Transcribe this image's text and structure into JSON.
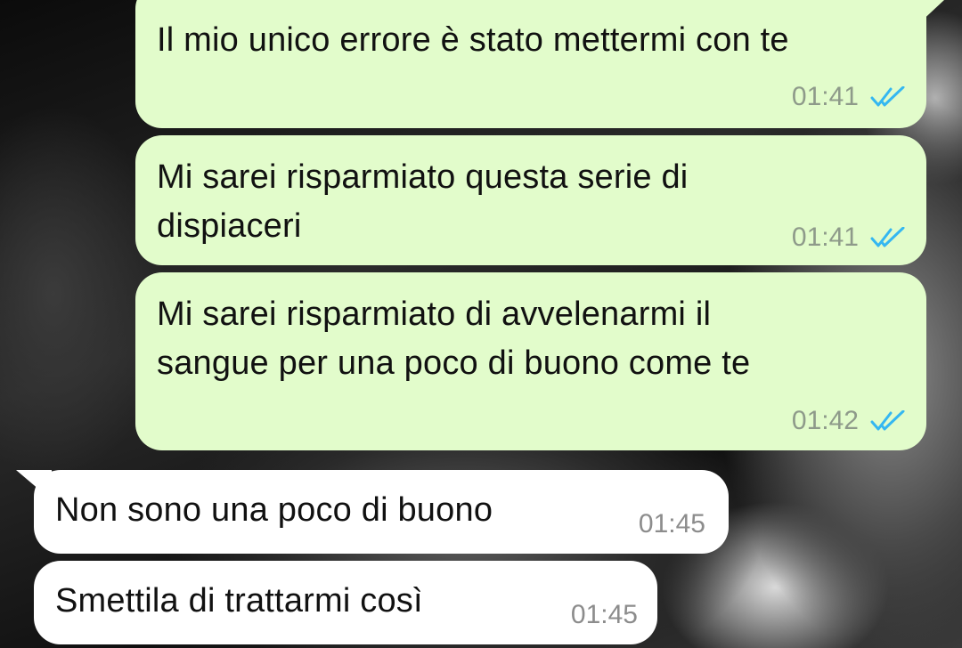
{
  "chat": {
    "messages": [
      {
        "direction": "outgoing",
        "lines": [
          "Il mio unico errore è stato mettermi con te"
        ],
        "time": "01:41",
        "status_icon": "double-check-read-icon"
      },
      {
        "direction": "outgoing",
        "lines": [
          "Mi sarei risparmiato questa serie di",
          "dispiaceri"
        ],
        "time": "01:41",
        "status_icon": "double-check-read-icon"
      },
      {
        "direction": "outgoing",
        "lines": [
          "Mi sarei risparmiato di avvelenarmi il",
          "sangue per una poco di buono come te"
        ],
        "time": "01:42",
        "status_icon": "double-check-read-icon"
      },
      {
        "direction": "incoming",
        "lines": [
          "Non sono una poco di buono"
        ],
        "time": "01:45"
      },
      {
        "direction": "incoming",
        "lines": [
          "Smettila di trattarmi così"
        ],
        "time": "01:45"
      }
    ]
  },
  "colors": {
    "outgoing_bubble": "#e2fccb",
    "incoming_bubble": "#ffffff",
    "read_ticks": "#34b7f1",
    "timestamp": "#8e9a8a"
  }
}
